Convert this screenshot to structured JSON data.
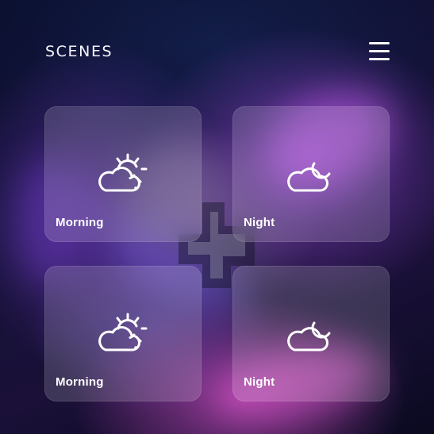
{
  "header": {
    "title": "SCENES",
    "menu_icon": "hamburger-menu-icon"
  },
  "scenes": [
    {
      "label": "Morning",
      "icon": "sun-behind-cloud-icon"
    },
    {
      "label": "Night",
      "icon": "moon-behind-cloud-icon"
    },
    {
      "label": "Morning",
      "icon": "sun-behind-cloud-icon"
    },
    {
      "label": "Night",
      "icon": "moon-behind-cloud-icon"
    }
  ],
  "colors": {
    "card_fill": "#ffffff29",
    "text": "#ffffff",
    "accent_purple": "#a04bd6",
    "accent_pink": "#d24fc4",
    "background_dark": "#0a0c1c"
  }
}
